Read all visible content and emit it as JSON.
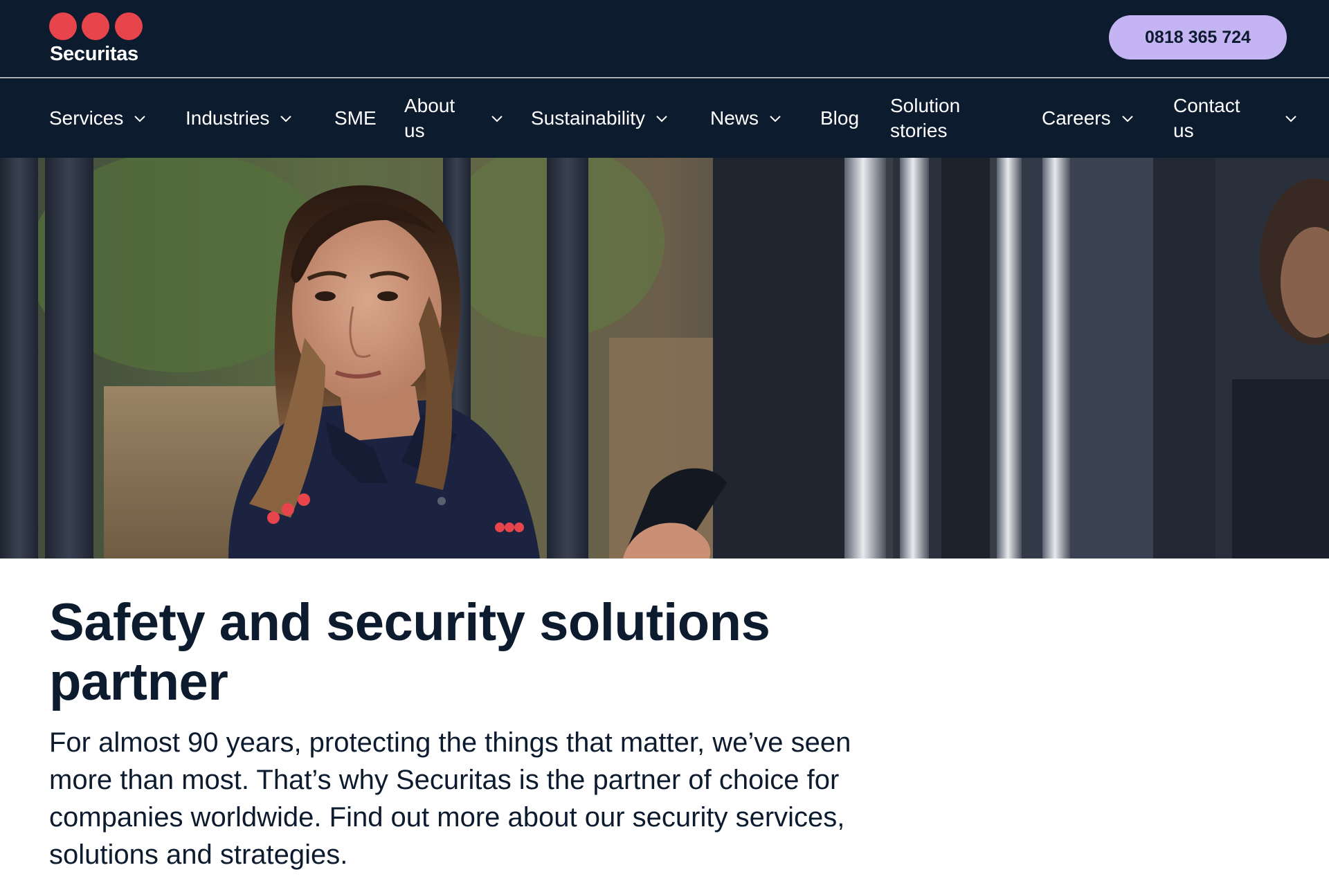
{
  "brand": {
    "name": "Securitas",
    "accent_color": "#e8444b",
    "header_bg": "#0d1b2e",
    "cta_color": "#c5b4f4"
  },
  "header": {
    "phone": "0818 365 724"
  },
  "nav": {
    "items": [
      {
        "label": "Services",
        "dropdown": true
      },
      {
        "label": "Industries",
        "dropdown": true
      },
      {
        "label": "SME",
        "dropdown": false
      },
      {
        "label": "About us",
        "dropdown": true
      },
      {
        "label": "Sustainability",
        "dropdown": true
      },
      {
        "label": "News",
        "dropdown": true
      },
      {
        "label": "Blog",
        "dropdown": false
      },
      {
        "label": "Solution stories",
        "dropdown": false
      },
      {
        "label": "Careers",
        "dropdown": true
      },
      {
        "label": "Contact us",
        "dropdown": true
      }
    ],
    "chevron_icon": "chevron-down-icon"
  },
  "hero": {
    "image": "security-officer-photo"
  },
  "main": {
    "headline": "Safety and security solutions partner",
    "lead": "For almost 90 years, protecting the things that matter, we’ve seen more than most. That’s why Securitas is the partner of choice for companies worldwide. Find out more about our security services, solutions and strategies."
  }
}
